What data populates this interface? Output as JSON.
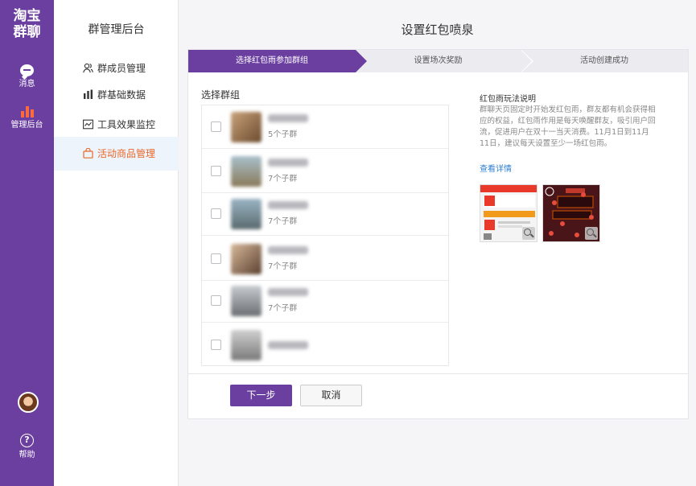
{
  "rail": {
    "logo_line1": "淘宝",
    "logo_line2": "群聊",
    "messages_label": "消息",
    "admin_label": "管理后台",
    "help_icon_glyph": "?",
    "help_label": "帮助"
  },
  "nav": {
    "title": "群管理后台",
    "items": [
      {
        "label": "群成员管理",
        "icon": "members-icon"
      },
      {
        "label": "群基础数据",
        "icon": "bar-chart-icon"
      },
      {
        "label": "工具效果监控",
        "icon": "line-chart-icon"
      },
      {
        "label": "活动商品管理",
        "icon": "bag-icon",
        "active": true
      }
    ]
  },
  "main": {
    "title": "设置红包喷泉",
    "steps": [
      "选择红包雨参加群组",
      "设置场次奖励",
      "活动创建成功"
    ],
    "section_title": "选择群组",
    "groups": [
      {
        "sub": "5个子群"
      },
      {
        "sub": "7个子群"
      },
      {
        "sub": "7个子群"
      },
      {
        "sub": "7个子群"
      },
      {
        "sub": "7个子群"
      },
      {
        "sub": ""
      }
    ],
    "rules": {
      "title": "红包雨玩法说明",
      "text": "群聊天页固定时开始发红包雨，群友都有机会获得相应的权益，红包雨作用是每天唤醒群友，吸引用户回流，促进用户在双十一当天消费。11月1日到11月11日，建议每天设置至少一场红包雨。",
      "link": "查看详情"
    },
    "buttons": {
      "next": "下一步",
      "cancel": "取消"
    }
  },
  "colors": {
    "brand_purple": "#6b3fa0",
    "accent_orange": "#e8682b",
    "link_blue": "#2d7fd1"
  }
}
